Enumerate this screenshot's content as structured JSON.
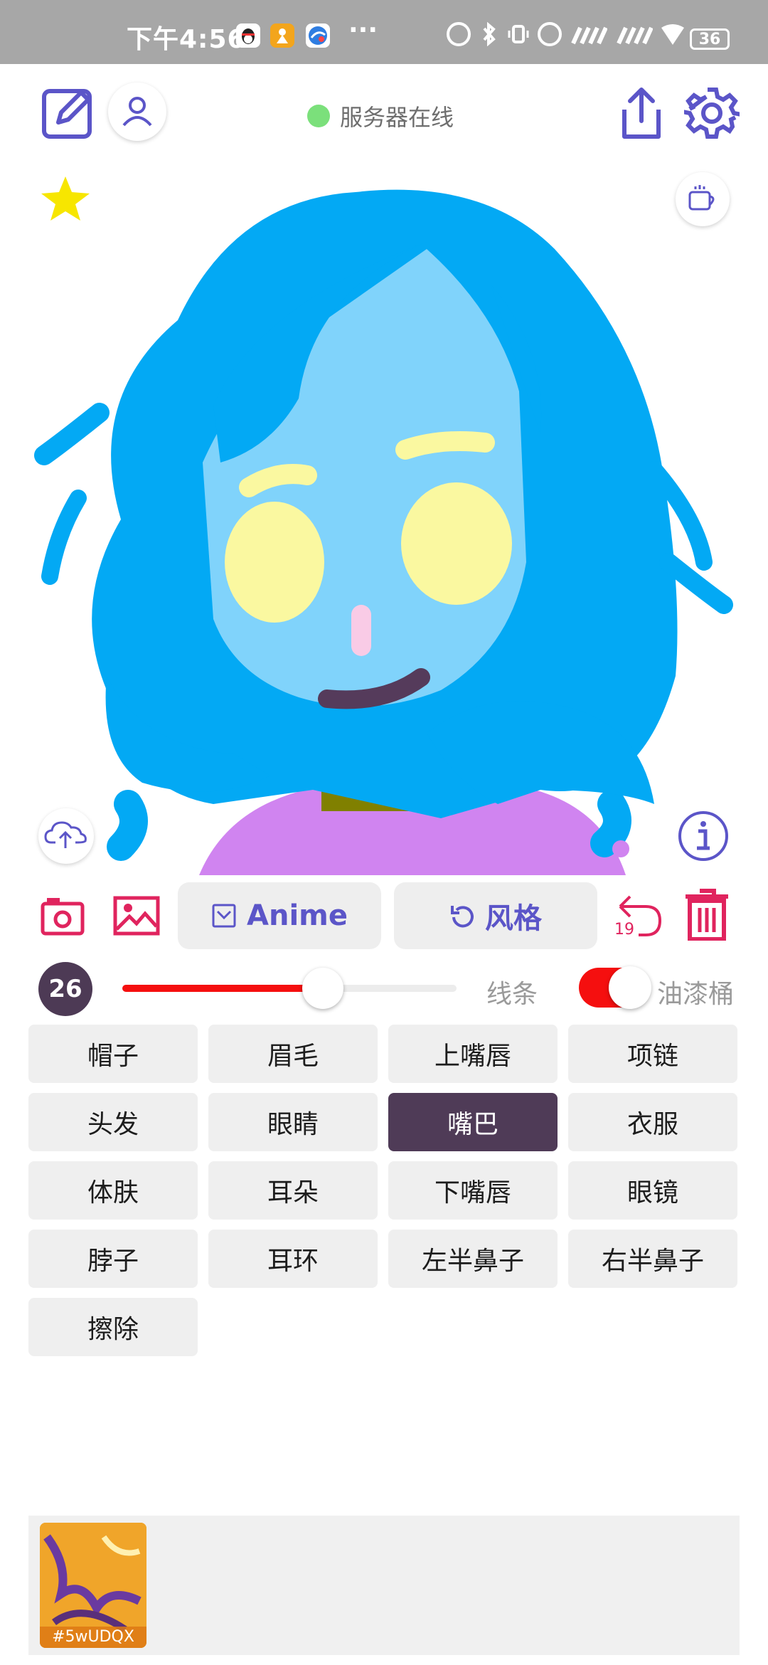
{
  "status_bar": {
    "time": "下午4:56",
    "dots": "···",
    "battery": "36"
  },
  "header": {
    "server_status": "服务器在线"
  },
  "toolbar": {
    "anime_label": "Anime",
    "style_label": "风格",
    "undo_count": "19"
  },
  "brush": {
    "size": "26",
    "slider_fraction": 0.6,
    "line_label": "线条",
    "bucket_label": "油漆桶",
    "bucket_enabled": true
  },
  "parts": [
    {
      "label": "帽子",
      "active": false
    },
    {
      "label": "眉毛",
      "active": false
    },
    {
      "label": "上嘴唇",
      "active": false
    },
    {
      "label": "项链",
      "active": false
    },
    {
      "label": "头发",
      "active": false
    },
    {
      "label": "眼睛",
      "active": false
    },
    {
      "label": "嘴巴",
      "active": true
    },
    {
      "label": "衣服",
      "active": false
    },
    {
      "label": "体肤",
      "active": false
    },
    {
      "label": "耳朵",
      "active": false
    },
    {
      "label": "下嘴唇",
      "active": false
    },
    {
      "label": "眼镜",
      "active": false
    },
    {
      "label": "脖子",
      "active": false
    },
    {
      "label": "耳环",
      "active": false
    },
    {
      "label": "左半鼻子",
      "active": false
    },
    {
      "label": "右半鼻子",
      "active": false
    },
    {
      "label": "擦除",
      "active": false
    }
  ],
  "gallery": {
    "items": [
      {
        "id": "#5wUDQX"
      }
    ]
  },
  "colors": {
    "accent": "#5b55c8",
    "danger": "#e0245e",
    "selected_part": "#4f3b57",
    "slider": "#f50f0f",
    "hair": "#03a9f4",
    "skin": "#80d3fb",
    "eyes": "#faf8a0",
    "mouth": "#553b5b",
    "neck": "#808000",
    "shirt": "#d084f0"
  }
}
